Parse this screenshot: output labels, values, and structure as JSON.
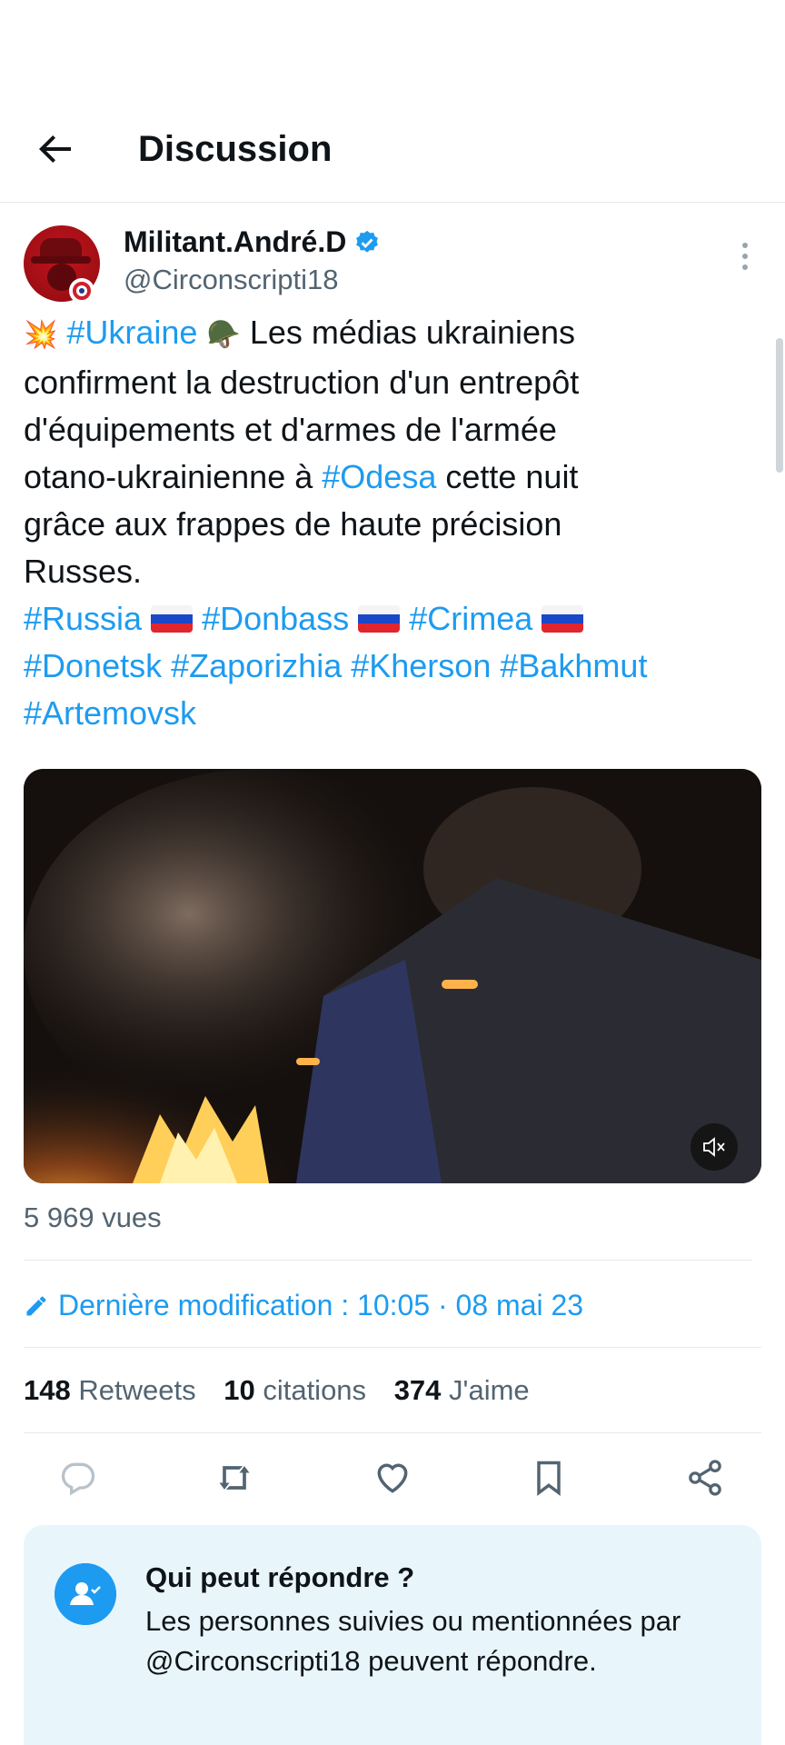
{
  "header": {
    "back_icon": "arrow-left-icon",
    "title": "Discussion"
  },
  "tweet": {
    "author_name": "Militant.André.D",
    "verified_icon": "verified-badge-icon",
    "handle": "@Circonscripti18",
    "more_icon": "more-vertical-icon",
    "body": {
      "emoji_collision": "💥",
      "tag_ukraine": "#Ukraine",
      "emoji_helmet": "🪖",
      "line1_rest": " Les médias ukrainiens",
      "line2": "confirment la destruction  d'un entrepôt",
      "line3": "d'équipements et d'armes de l'armée",
      "line4_pre": "otano-ukrainienne à ",
      "tag_odesa": "#Odesa",
      "line4_post": " cette nuit",
      "line5": "grâce aux frappes de haute précision",
      "line6": "Russes.",
      "tag_russia": "#Russia",
      "tag_donbass": "#Donbass",
      "tag_crimea": "#Crimea",
      "tag_donetsk": "#Donetsk",
      "tag_zaporizhia": "#Zaporizhia",
      "tag_kherson": "#Kherson",
      "tag_bakhmut": "#Bakhmut",
      "tag_artemovsk": "#Artemovsk"
    },
    "media": {
      "mute_icon": "volume-mute-icon"
    },
    "views": "5 969 vues",
    "edit": {
      "icon": "pencil-icon",
      "label": "Dernière modification : 10:05 · 08 mai 23"
    },
    "stats": {
      "retweets_count": "148",
      "retweets_label": "Retweets",
      "quotes_count": "10",
      "quotes_label": "citations",
      "likes_count": "374",
      "likes_label": "J'aime"
    },
    "actions": [
      "reply-icon",
      "retweet-icon",
      "like-icon",
      "bookmark-icon",
      "share-icon"
    ]
  },
  "reply_restriction": {
    "icon": "user-check-icon",
    "title": "Qui peut répondre ?",
    "description": "Les personnes suivies ou mentionnées par @Circonscripti18 peuvent répondre."
  },
  "colors": {
    "accent": "#1d9bf0",
    "text": "#0f1419",
    "secondary": "#536471",
    "reply_box_bg": "#e8f6fc"
  }
}
